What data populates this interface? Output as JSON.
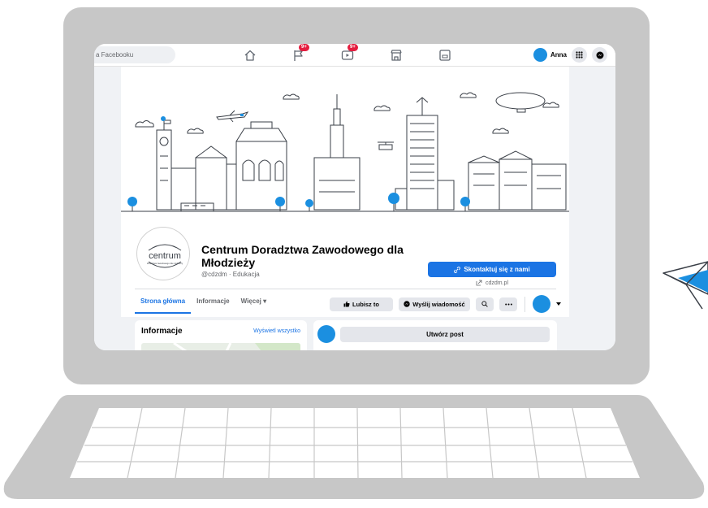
{
  "topbar": {
    "search_placeholder": "a Facebooku",
    "notifications": {
      "pages_badge": "9+",
      "watch_badge": "9+"
    },
    "profile_name": "Anna",
    "icons": [
      "home-icon",
      "flag-icon",
      "video-icon",
      "store-icon",
      "gaming-icon",
      "grid-menu-icon",
      "messenger-icon"
    ]
  },
  "page": {
    "logo_text": "centrum",
    "logo_subtext": "doradztwa zawodowego dla młodzieży",
    "name": "Centrum Doradztwa Zawodowego dla Młodzieży",
    "handle_category": "@cdzdm · Edukacja",
    "contact_label": "Skontaktuj się z nami",
    "website": "cdzdm.pl"
  },
  "tabs": [
    {
      "label": "Strona główna",
      "active": true
    },
    {
      "label": "Informacje",
      "active": false
    },
    {
      "label": "Więcej ▾",
      "active": false
    }
  ],
  "actions": {
    "like_label": "Lubisz to",
    "message_label": "Wyślij wiadomość"
  },
  "info_card": {
    "title": "Informacje",
    "link": "Wyświetl wszystko"
  },
  "post_card": {
    "create_label": "Utwórz post"
  },
  "colors": {
    "accent": "#1b74e4",
    "avatar": "#1b8fe0",
    "badge": "#e41e3f",
    "laptop": "#c7c7c7",
    "water": "#bfe3f5"
  }
}
